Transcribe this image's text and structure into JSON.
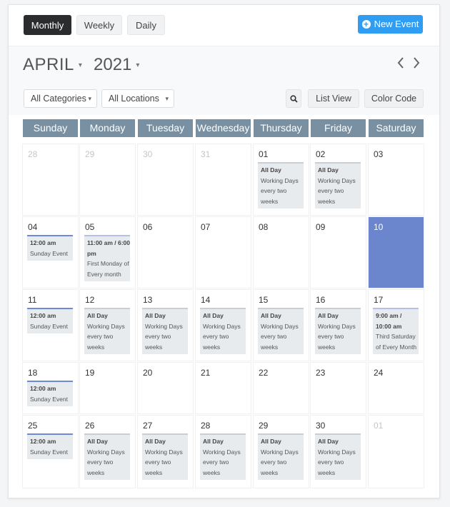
{
  "toolbar": {
    "views": [
      "Monthly",
      "Weekly",
      "Daily"
    ],
    "new_event": "New Event"
  },
  "header": {
    "month": "APRIL",
    "year": "2021",
    "categories": "All Categories",
    "locations": "All Locations",
    "list_view": "List View",
    "color_code": "Color Code"
  },
  "weekdays": [
    "Sunday",
    "Monday",
    "Tuesday",
    "Wednesday",
    "Thursday",
    "Friday",
    "Saturday"
  ],
  "calendar": {
    "today": "10",
    "weeks": [
      [
        {
          "day": "28",
          "muted": true,
          "events": []
        },
        {
          "day": "29",
          "muted": true,
          "events": []
        },
        {
          "day": "30",
          "muted": true,
          "events": []
        },
        {
          "day": "31",
          "muted": true,
          "events": []
        },
        {
          "day": "01",
          "events": [
            {
              "time": "All Day",
              "text": "Working Days every two weeks",
              "kind": "working"
            }
          ]
        },
        {
          "day": "02",
          "events": [
            {
              "time": "All Day",
              "text": "Working Days every two weeks",
              "kind": "working"
            }
          ]
        },
        {
          "day": "03",
          "events": []
        }
      ],
      [
        {
          "day": "04",
          "events": [
            {
              "time": "12:00 am",
              "text": "Sunday Event",
              "kind": "sunday"
            }
          ]
        },
        {
          "day": "05",
          "events": [
            {
              "time": "11:00 am / 6:00 pm",
              "text": "First Monday of Every month",
              "kind": "monthly"
            }
          ]
        },
        {
          "day": "06",
          "events": []
        },
        {
          "day": "07",
          "events": []
        },
        {
          "day": "08",
          "events": []
        },
        {
          "day": "09",
          "events": []
        },
        {
          "day": "10",
          "today": true,
          "events": []
        }
      ],
      [
        {
          "day": "11",
          "events": [
            {
              "time": "12:00 am",
              "text": "Sunday Event",
              "kind": "sunday"
            }
          ]
        },
        {
          "day": "12",
          "events": [
            {
              "time": "All Day",
              "text": "Working Days every two weeks",
              "kind": "working"
            }
          ]
        },
        {
          "day": "13",
          "events": [
            {
              "time": "All Day",
              "text": "Working Days every two weeks",
              "kind": "working"
            }
          ]
        },
        {
          "day": "14",
          "events": [
            {
              "time": "All Day",
              "text": "Working Days every two weeks",
              "kind": "working"
            }
          ]
        },
        {
          "day": "15",
          "events": [
            {
              "time": "All Day",
              "text": "Working Days every two weeks",
              "kind": "working"
            }
          ]
        },
        {
          "day": "16",
          "events": [
            {
              "time": "All Day",
              "text": "Working Days every two weeks",
              "kind": "working"
            }
          ]
        },
        {
          "day": "17",
          "events": [
            {
              "time": "9:00 am / 10:00 am",
              "text": "Third Saturday of Every Month",
              "kind": "monthly"
            }
          ]
        }
      ],
      [
        {
          "day": "18",
          "events": [
            {
              "time": "12:00 am",
              "text": "Sunday Event",
              "kind": "sunday"
            }
          ]
        },
        {
          "day": "19",
          "events": []
        },
        {
          "day": "20",
          "events": []
        },
        {
          "day": "21",
          "events": []
        },
        {
          "day": "22",
          "events": []
        },
        {
          "day": "23",
          "events": []
        },
        {
          "day": "24",
          "events": []
        }
      ],
      [
        {
          "day": "25",
          "events": [
            {
              "time": "12:00 am",
              "text": "Sunday Event",
              "kind": "sunday"
            }
          ]
        },
        {
          "day": "26",
          "events": [
            {
              "time": "All Day",
              "text": "Working Days every two weeks",
              "kind": "working"
            }
          ]
        },
        {
          "day": "27",
          "events": [
            {
              "time": "All Day",
              "text": "Working Days every two weeks",
              "kind": "working"
            }
          ]
        },
        {
          "day": "28",
          "events": [
            {
              "time": "All Day",
              "text": "Working Days every two weeks",
              "kind": "working"
            }
          ]
        },
        {
          "day": "29",
          "events": [
            {
              "time": "All Day",
              "text": "Working Days every two weeks",
              "kind": "working"
            }
          ]
        },
        {
          "day": "30",
          "events": [
            {
              "time": "All Day",
              "text": "Working Days every two weeks",
              "kind": "working"
            }
          ]
        },
        {
          "day": "01",
          "muted": true,
          "events": []
        }
      ]
    ]
  },
  "colors": {
    "accent": "#2f9ef2",
    "day_header": "#7890a1",
    "today": "#6b86cd",
    "active_view": "#2b2c2e"
  }
}
